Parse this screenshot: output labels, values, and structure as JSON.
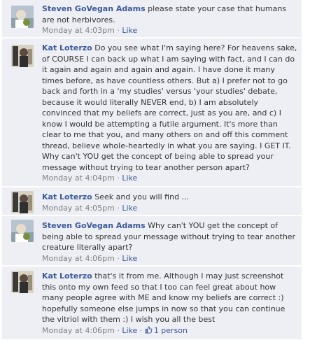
{
  "comments": [
    {
      "author": "Steven GoVegan Adams",
      "text": "please state your case that humans are not herbivores.",
      "time": "Monday at 4:03pm",
      "sep": " · ",
      "like": "Like",
      "avatar": "steven-avatar"
    },
    {
      "author": "Kat Loterzo",
      "text": "Do you see what I'm saying here? For heavens sake, of COURSE I can back up what I am saying with fact, and I can do it again and again and again and again. I have done it many times before, as have countless others. But a) I prefer not to go back and forth in a 'my studies' versus 'your studies' debate, because it would literally NEVER end, b) I am absolutely convinced that my beliefs are correct, just as you are, and c) I know I would be attempting a futile argument. It's more than clear to me that you, and many others on and off this comment thread, believe whole-heartedly in what you are saying. I GET IT. Why can't YOU get the concept of being able to spread your message without trying to tear another person apart?",
      "time": "Monday at 4:04pm",
      "sep": " · ",
      "like": "Like",
      "avatar": "kat-avatar"
    },
    {
      "author": "Kat Loterzo",
      "text": "Seek and you will find ...",
      "time": "Monday at 4:05pm",
      "sep": " · ",
      "like": "Like",
      "avatar": "kat-avatar"
    },
    {
      "author": "Steven GoVegan Adams",
      "text": "Why can't YOU get the concept of being able to spread your message without trying to tear another creature literally apart?",
      "time": "Monday at 4:06pm",
      "sep": " · ",
      "like": "Like",
      "avatar": "steven-avatar"
    },
    {
      "author": "Kat Loterzo",
      "text": "that's it from me. Although I may just screenshot this onto my own feed so that I too can feel great about how many people agree with ME and know my beliefs are correct :) hopefully someone else jumps in now so that you can continue the vitriol with them :) I wish you all the best",
      "time": "Monday at 4:06pm",
      "sep": " · ",
      "like": "Like",
      "sep2": " · ",
      "likes_count": "1 person",
      "avatar": "kat-avatar"
    }
  ],
  "colors": {
    "background": "#edeff4",
    "link": "#3b5998",
    "meta": "#808080",
    "text": "#333333"
  }
}
